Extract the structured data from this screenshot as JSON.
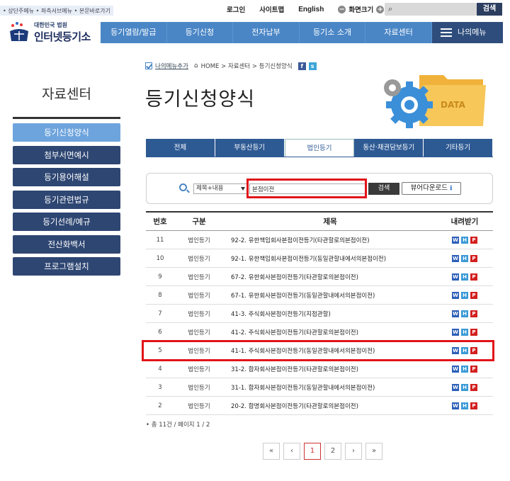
{
  "skip_nav": "• 상단주메뉴 • 좌측서브메뉴 • 본문바로가기",
  "util": {
    "login": "로그인",
    "sitemap": "사이트맵",
    "english": "English",
    "zoom": "화면크기",
    "zoom_minus": "−",
    "zoom_plus": "+",
    "search_btn": "검색"
  },
  "logo": {
    "sub": "대한민국 법원",
    "main": "인터넷등기소"
  },
  "gnb": [
    "등기열람/발급",
    "등기신청",
    "전자납부",
    "등기소 소개",
    "자료센터"
  ],
  "my_menu": "나의메뉴",
  "lnb": {
    "title": "자료센터",
    "items": [
      "등기신청양식",
      "첨부서면예시",
      "등기용어해설",
      "등기관련법규",
      "등기선례/예규",
      "전산화백서",
      "프로그램설치"
    ],
    "active_index": 0
  },
  "breadcrumb": {
    "add_my": "나의메뉴추가",
    "path": "HOME > 자료센터 > 등기신청양식",
    "fb": "f",
    "share": "s"
  },
  "page_title": "등기신청양식",
  "deco_label": "DATA",
  "tabs": [
    "전체",
    "부동산등기",
    "법인등기",
    "동산·채권담보등기",
    "기타등기"
  ],
  "active_tab": 2,
  "search": {
    "field": "제목+내용",
    "query": "본점이전",
    "button": "검색",
    "viewer": "뷰어다운로드"
  },
  "table": {
    "headers": [
      "번호",
      "구분",
      "제목",
      "내려받기"
    ],
    "rows": [
      {
        "no": "11",
        "type": "법인등기",
        "title": "92-2. 유한책임회사본점이전등기(타관할로의본점이전)"
      },
      {
        "no": "10",
        "type": "법인등기",
        "title": "92-1. 유한책임회사본점이전등기(동일관할내에서의본점이전)"
      },
      {
        "no": "9",
        "type": "법인등기",
        "title": "67-2. 유한회사본점이전등기(타관할로의본점이전)"
      },
      {
        "no": "8",
        "type": "법인등기",
        "title": "67-1. 유한회사본점이전등기(동일관할내에서의본점이전)"
      },
      {
        "no": "7",
        "type": "법인등기",
        "title": "41-3. 주식회사본점이전등기(지점관할)"
      },
      {
        "no": "6",
        "type": "법인등기",
        "title": "41-2. 주식회사본점이전등기(타관할로의본점이전)"
      },
      {
        "no": "5",
        "type": "법인등기",
        "title": "41-1. 주식회사본점이전등기(동일관할내에서의본점이전)"
      },
      {
        "no": "4",
        "type": "법인등기",
        "title": "31-2. 합자회사본점이전등기(타관할로의본점이전)"
      },
      {
        "no": "3",
        "type": "법인등기",
        "title": "31-1. 합자회사본점이전등기(동일관할내에서의본점이전)"
      },
      {
        "no": "2",
        "type": "법인등기",
        "title": "20-2. 합명회사본점이전등기(타관할로의본점이전)"
      }
    ],
    "file_icons": [
      "W",
      "H",
      "P"
    ]
  },
  "total": "• 총 11건 / 페이지 1 / 2",
  "pager": {
    "first": "«",
    "prev": "‹",
    "pages": [
      "1",
      "2"
    ],
    "current": "1",
    "next": "›",
    "last": "»"
  },
  "colors": {
    "nav": "#4a86c6",
    "dark": "#2e4672",
    "active": "#6ea4dd",
    "highlight": "#e1141a"
  }
}
